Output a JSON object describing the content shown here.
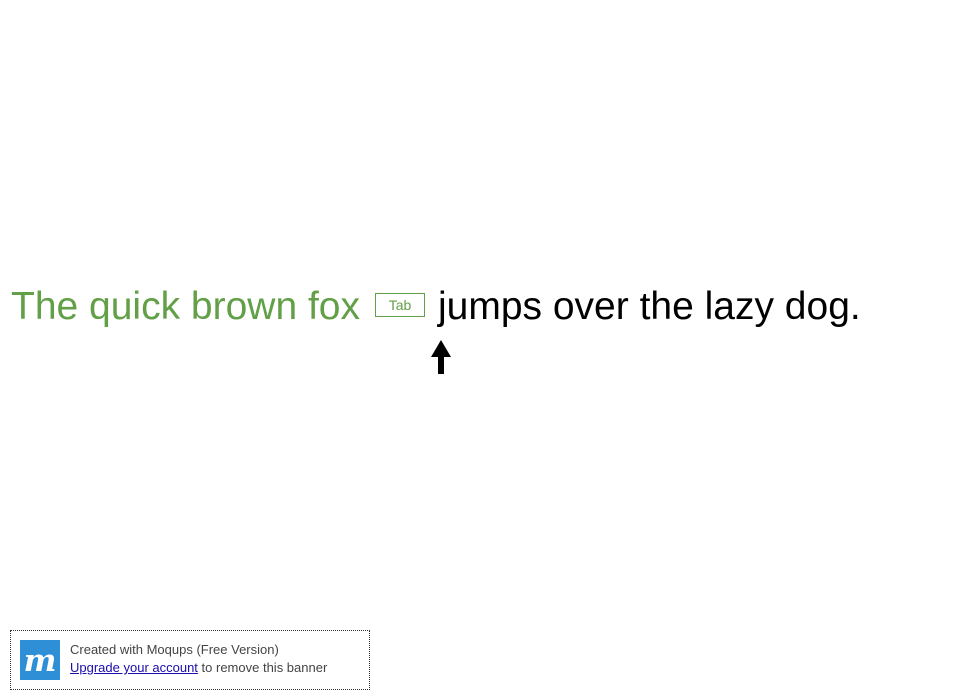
{
  "sentence": {
    "typed_text": "The quick brown fox",
    "remaining_text": "jumps over the lazy dog.",
    "typed_color": "#62a047",
    "remaining_color": "#000000"
  },
  "key_hint": {
    "label": "Tab"
  },
  "pointer": {
    "icon": "up-arrow-icon"
  },
  "banner": {
    "logo_icon": "moqups-logo-icon",
    "created_text": "Created with Moqups (Free Version)",
    "upgrade_link": "Upgrade your account",
    "suffix_text": "to remove this banner",
    "accent_color": "#2e8fd6"
  }
}
